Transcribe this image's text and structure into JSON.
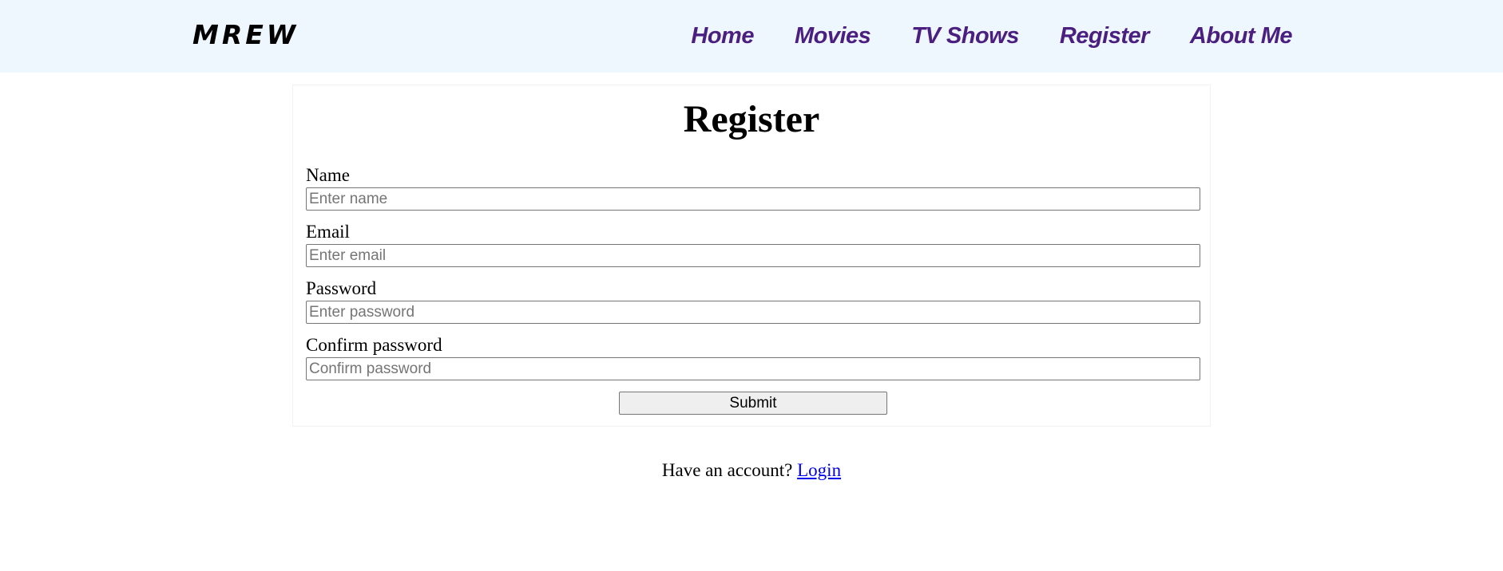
{
  "navbar": {
    "brand": "MREW",
    "links": [
      "Home",
      "Movies",
      "TV Shows",
      "Register",
      "About Me"
    ],
    "background_color": "#eff7fe",
    "link_color": "#4a1f80"
  },
  "form": {
    "title": "Register",
    "fields": [
      {
        "label": "Name",
        "placeholder": "Enter name",
        "value": ""
      },
      {
        "label": "Email",
        "placeholder": "Enter email",
        "value": ""
      },
      {
        "label": "Password",
        "placeholder": "Enter password",
        "value": ""
      },
      {
        "label": "Confirm password",
        "placeholder": "Confirm password",
        "value": ""
      }
    ],
    "submit_label": "Submit"
  },
  "footer": {
    "prompt": "Have an account?",
    "login_link": "Login",
    "link_color": "#0000ee"
  }
}
